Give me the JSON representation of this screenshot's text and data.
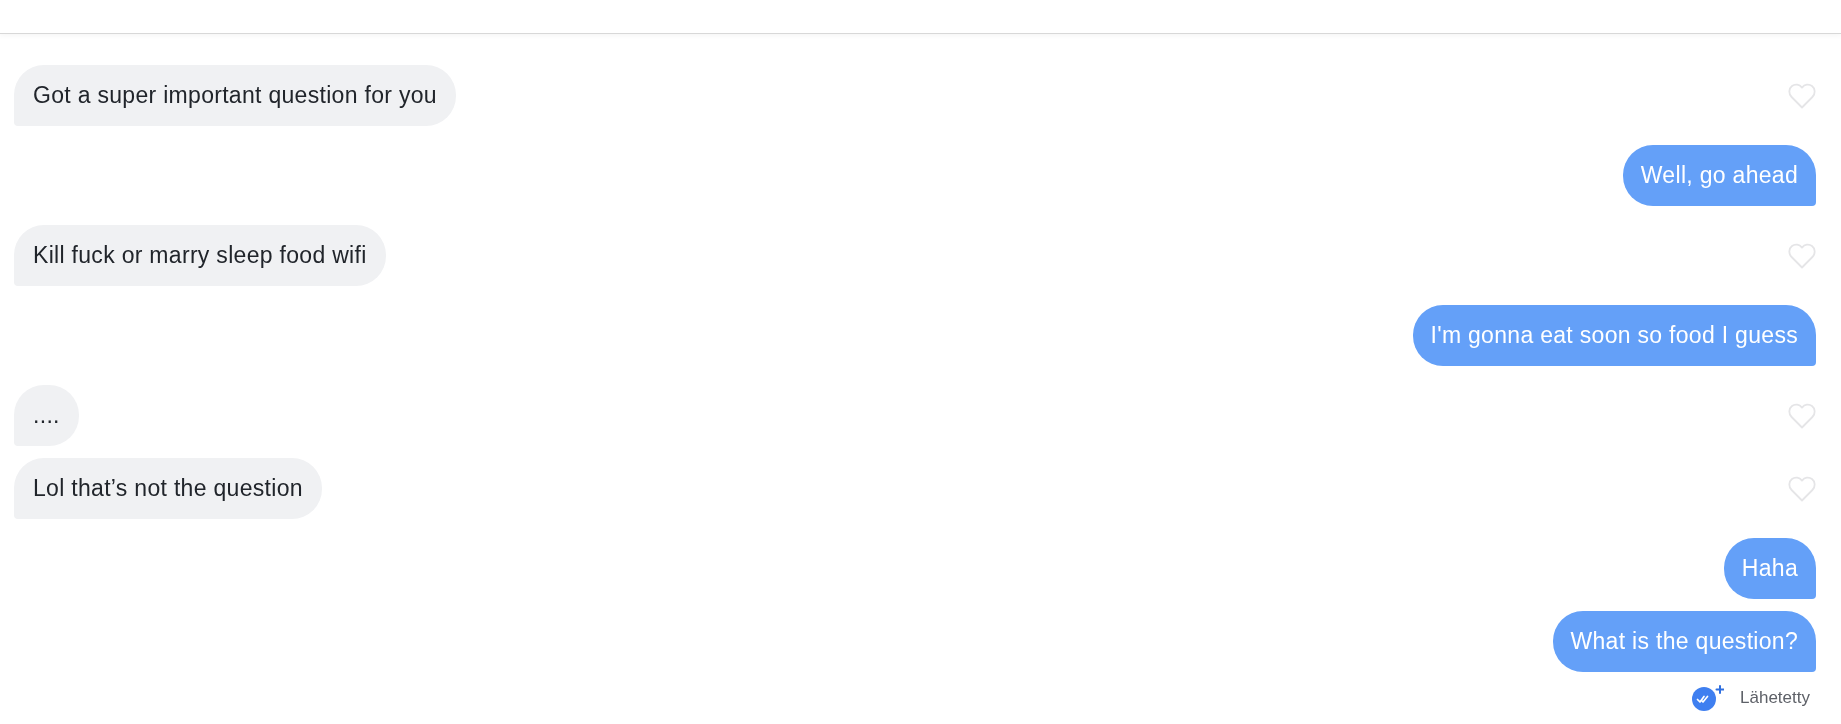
{
  "messages": [
    {
      "kind": "received",
      "text": "Got a super important question for you",
      "liked": false
    },
    {
      "kind": "sent",
      "text": "Well, go ahead"
    },
    {
      "kind": "received",
      "text": "Kill fuck or marry sleep food wifi",
      "liked": false
    },
    {
      "kind": "sent",
      "text": "I'm gonna eat soon so food I guess"
    },
    {
      "kind": "received",
      "text": "....",
      "liked": false
    },
    {
      "kind": "received",
      "text": "Lol that’s not the question",
      "liked": false
    },
    {
      "kind": "sent",
      "text": "Haha"
    },
    {
      "kind": "sent",
      "text": "What is the question?"
    }
  ],
  "receipt": {
    "label": "Lähetetty"
  }
}
